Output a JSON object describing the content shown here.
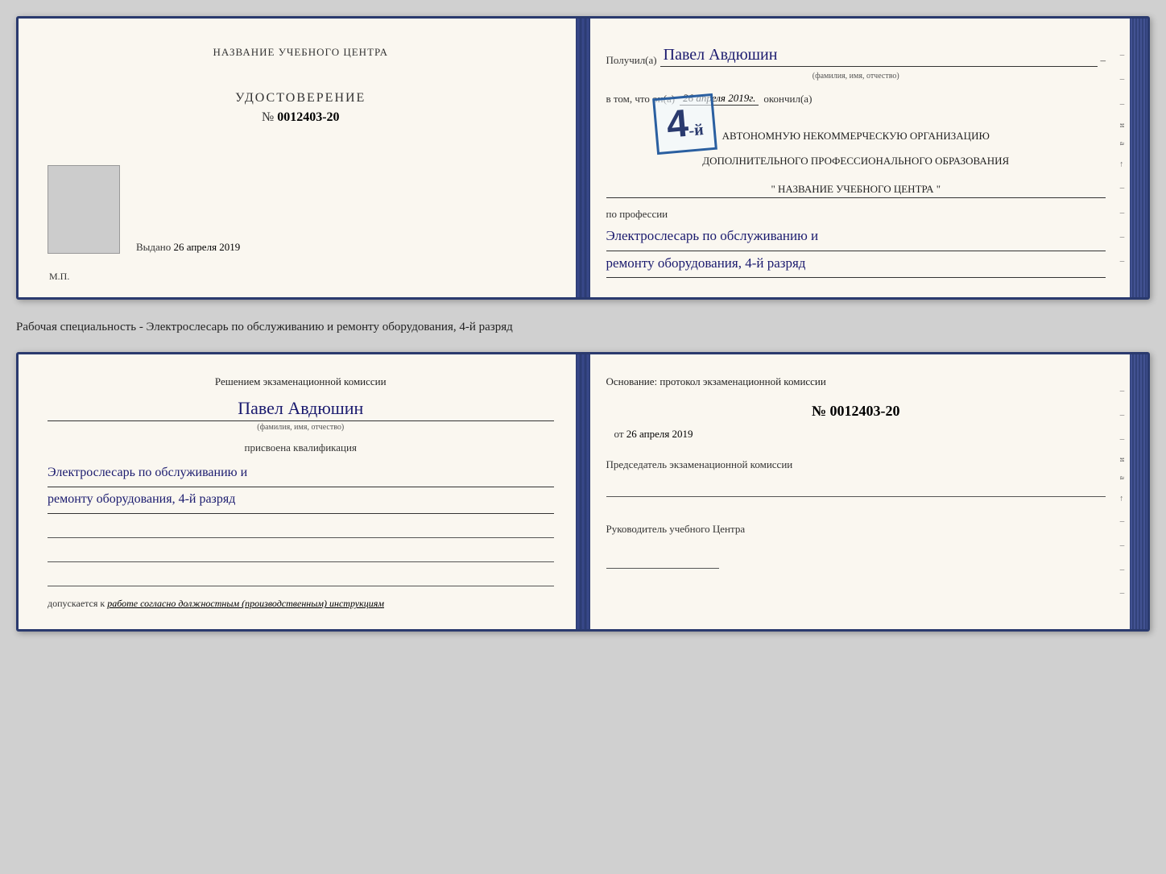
{
  "doc1": {
    "left": {
      "institution_label": "НАЗВАНИЕ УЧЕБНОГО ЦЕНТРА",
      "cert_title": "УДОСТОВЕРЕНИЕ",
      "cert_number_prefix": "№",
      "cert_number": "0012403-20",
      "issued_label": "Выдано",
      "issued_date": "26 апреля 2019",
      "mp_label": "М.П."
    },
    "right": {
      "received_label": "Получил(а)",
      "person_name": "Павел Авдюшин",
      "person_name_sub": "(фамилия, имя, отчество)",
      "since_label": "в том, что он(а)",
      "since_date": "26 апреля 2019г.",
      "finished_label": "окончил(а)",
      "grade": "4-й",
      "org_line1": "АВТОНОМНУЮ НЕКОММЕРЧЕСКУЮ ОРГАНИЗАЦИЮ",
      "org_line2": "ДОПОЛНИТЕЛЬНОГО ПРОФЕССИОНАЛЬНОГО ОБРАЗОВАНИЯ",
      "org_name": "\" НАЗВАНИЕ УЧЕБНОГО ЦЕНТРА \"",
      "profession_label": "по профессии",
      "profession_line1": "Электрослесарь по обслуживанию и",
      "profession_line2": "ремонту оборудования, 4-й разряд"
    }
  },
  "specialty_text": "Рабочая специальность - Электрослесарь по обслуживанию и ремонту оборудования, 4-й разряд",
  "doc2": {
    "left": {
      "decision_title": "Решением экзаменационной комиссии",
      "person_name": "Павел Авдюшин",
      "person_name_sub": "(фамилия, имя, отчество)",
      "assigned_label": "присвоена квалификация",
      "qualification_line1": "Электрослесарь по обслуживанию и",
      "qualification_line2": "ремонту оборудования, 4-й разряд",
      "admitted_label": "допускается к",
      "admitted_italic": "работе согласно должностным (производственным) инструкциям"
    },
    "right": {
      "basis_title": "Основание: протокол экзаменационной комиссии",
      "protocol_prefix": "№",
      "protocol_number": "0012403-20",
      "date_from_label": "от",
      "date_from_value": "26 апреля 2019",
      "chairman_label": "Председатель экзаменационной комиссии",
      "director_label": "Руководитель учебного Центра"
    }
  }
}
